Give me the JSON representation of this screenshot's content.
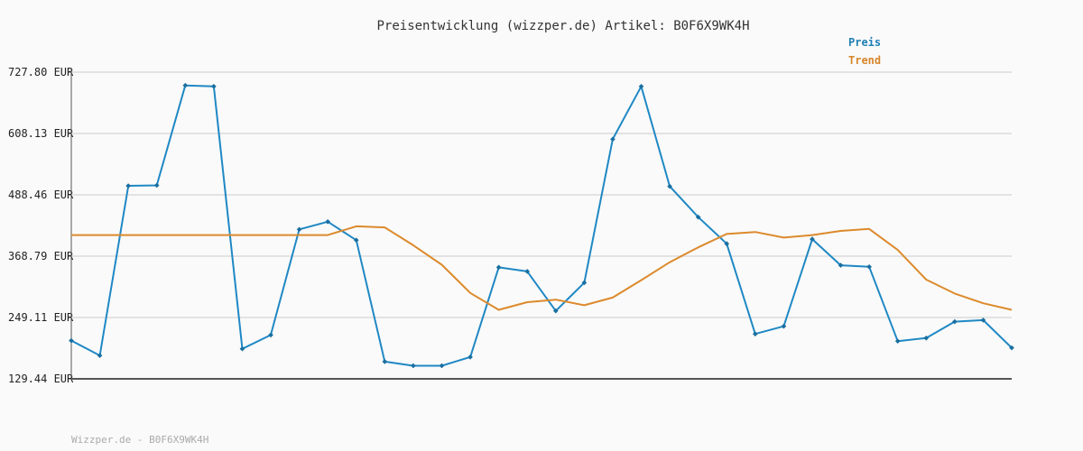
{
  "chart_data": {
    "type": "line",
    "title": "Preisentwicklung (wizzper.de) Artikel: B0F6X9WK4H",
    "y_ticks": [
      "727.80 EUR",
      "608.13 EUR",
      "488.46 EUR",
      "368.79 EUR",
      "249.11 EUR",
      "129.44 EUR"
    ],
    "y_tick_values": [
      727.8,
      608.13,
      488.46,
      368.79,
      249.11,
      129.44
    ],
    "ylim": [
      129.44,
      727.8
    ],
    "grid": true,
    "legend_position": "top-right",
    "series": [
      {
        "name": "Preis",
        "color": "#1f88c4",
        "markers": true,
        "values": [
          204,
          175,
          506,
          507,
          702,
          700,
          188,
          215,
          421,
          436,
          400,
          163,
          155,
          155,
          172,
          347,
          339,
          262,
          317,
          597,
          700,
          505,
          445,
          393,
          217,
          232,
          402,
          351,
          348,
          203,
          209,
          241,
          244,
          190
        ]
      },
      {
        "name": "Trend",
        "color": "#dc8a2c",
        "markers": false,
        "values": [
          410,
          410,
          410,
          410,
          410,
          410,
          410,
          410,
          410,
          410,
          427,
          425,
          390,
          352,
          297,
          264,
          279,
          284,
          273,
          288,
          322,
          357,
          386,
          412,
          416,
          405,
          410,
          418,
          422,
          381,
          323,
          296,
          277,
          264
        ]
      }
    ]
  },
  "footer": "Wizzper.de - B0F6X9WK4H"
}
